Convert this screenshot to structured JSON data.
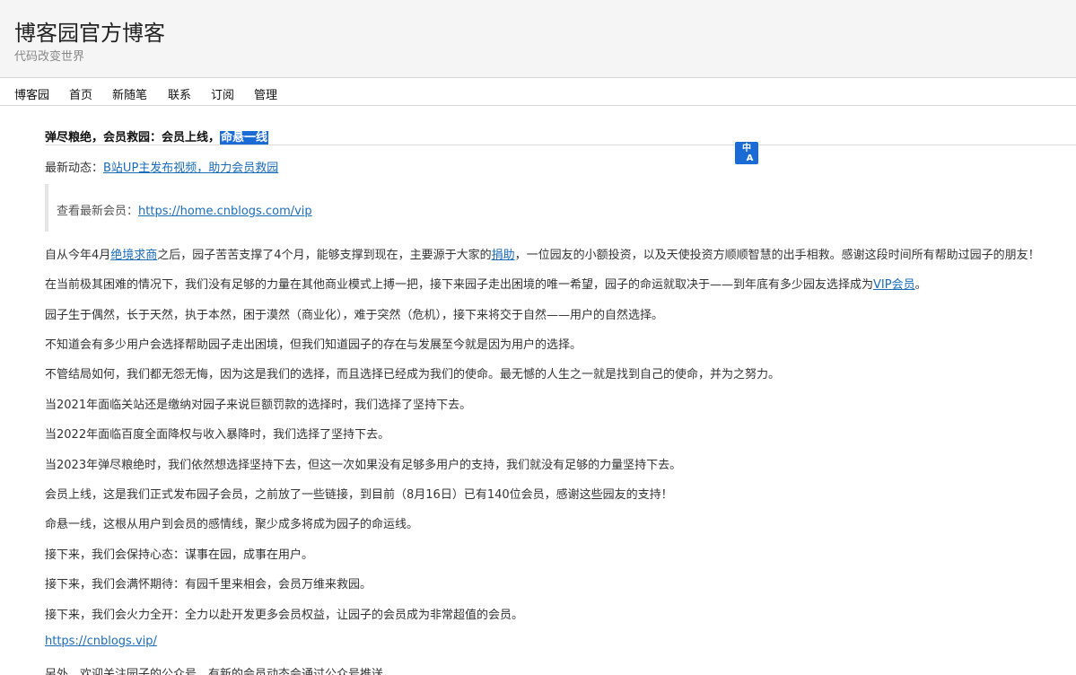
{
  "header": {
    "title": "博客园官方博客",
    "subtitle": "代码改变世界"
  },
  "nav": {
    "items": [
      "博客园",
      "首页",
      "新随笔",
      "联系",
      "订阅",
      "管理"
    ]
  },
  "post": {
    "title_main": "弹尽粮绝，会员救园：会员上线，",
    "title_highlight": "命悬一线",
    "news_label": "最新动态：",
    "news_link": "B站UP主发布视频，助力会员救园",
    "quote_label": "查看最新会员：",
    "quote_link": "https://home.cnblogs.com/vip",
    "p1_a": "自从今年4月",
    "p1_link1": "绝境求商",
    "p1_b": "之后，园子苦苦支撑了4个月，能够支撑到现在，主要源于大家的",
    "p1_link2": "捐助",
    "p1_c": "，一位园友的小额投资，以及天使投资方顺顺智慧的出手相救。感谢这段时间所有帮助过园子的朋友！",
    "p2_a": "在当前极其困难的情况下，我们没有足够的力量在其他商业模式上搏一把，接下来园子走出困境的唯一希望，园子的命运就取决于——到年底有多少园友选择成为",
    "p2_link": "VIP会员",
    "p2_b": "。",
    "p3": "园子生于偶然，长于天然，执于本然，困于漠然（商业化），难于突然（危机），接下来将交于自然——用户的自然选择。",
    "p4": "不知道会有多少用户会选择帮助园子走出困境，但我们知道园子的存在与发展至今就是因为用户的选择。",
    "p5": "不管结局如何，我们都无怨无悔，因为这是我们的选择，而且选择已经成为我们的使命。最无憾的人生之一就是找到自己的使命，并为之努力。",
    "p6": "当2021年面临关站还是缴纳对园子来说巨额罚款的选择时，我们选择了坚持下去。",
    "p7": "当2022年面临百度全面降权与收入暴降时，我们选择了坚持下去。",
    "p8": "当2023年弹尽粮绝时，我们依然想选择坚持下去，但这一次如果没有足够多用户的支持，我们就没有足够的力量坚持下去。",
    "p9": "会员上线，这是我们正式发布园子会员，之前放了一些链接，到目前（8月16日）已有140位会员，感谢这些园友的支持！",
    "p10": "命悬一线，这根从用户到会员的感情线，聚少成多将成为园子的命运线。",
    "p11": "接下来，我们会保持心态：谋事在园，成事在用户。",
    "p12": "接下来，我们会满怀期待：有园千里来相会，会员万维来救园。",
    "p13": "接下来，我们会火力全开：全力以赴开发更多会员权益，让园子的会员成为非常超值的会员。",
    "p14_link": "https://cnblogs.vip/",
    "p15": "另外，欢迎关注园子的公众号，有新的会员动态会通过公众号推送。"
  },
  "icons": {
    "translate": "translate-icon"
  },
  "colors": {
    "link": "#1a6bb8",
    "highlight": "#1a6bd6"
  }
}
